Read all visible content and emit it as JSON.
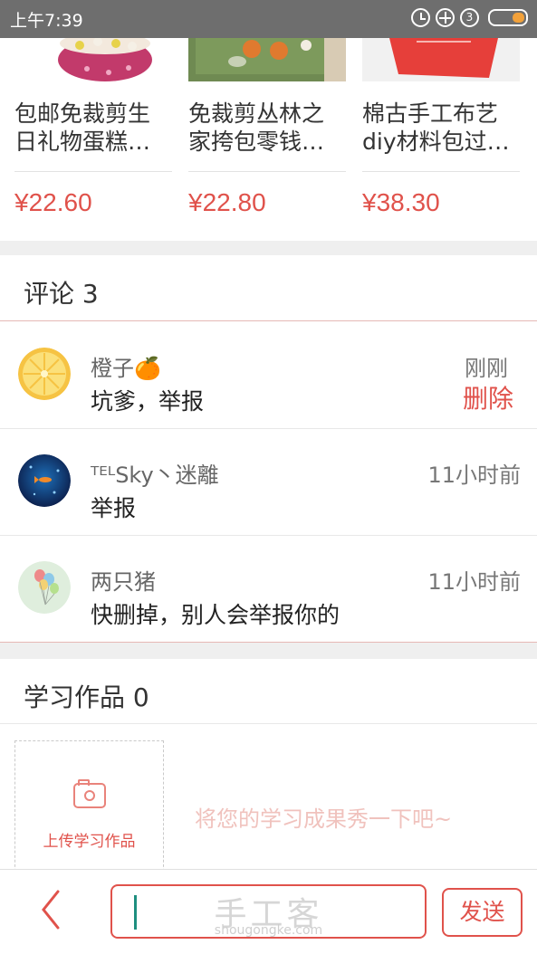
{
  "status_bar": {
    "time": "上午7:39",
    "sim_label": "3",
    "battery_level": 0.35,
    "battery_color": "#f2a13a"
  },
  "products": [
    {
      "name": "包邮免裁剪生日礼物蛋糕…",
      "price": "¥22.60",
      "thumb_color": "#f4eef1"
    },
    {
      "name": "免裁剪丛林之家挎包零钱…",
      "price": "¥22.80",
      "thumb_color": "#6f8a52"
    },
    {
      "name": "棉古手工布艺diy材料包过…",
      "price": "¥38.30",
      "thumb_color": "#e63f3a"
    }
  ],
  "comments_section": {
    "title": "评论 3",
    "items": [
      {
        "user": "橙子🍊",
        "text": "坑爹，举报",
        "time": "刚刚",
        "delete_label": "删除",
        "avatar": "orange-slice-avatar"
      },
      {
        "user": "ᵀᴱᴸSky丶迷離",
        "text": "举报",
        "time": "11小时前",
        "avatar": "fish-avatar"
      },
      {
        "user": "两只猪",
        "text": "快删掉，别人会举报你的",
        "time": "11小时前",
        "avatar": "balloons-avatar"
      }
    ]
  },
  "works_section": {
    "title": "学习作品 0",
    "upload_label": "上传学习作品",
    "empty_hint": "将您的学习成果秀一下吧~"
  },
  "bottom_bar": {
    "watermark_cn": "手工客",
    "watermark_en": "shougongke.com",
    "send_label": "发送"
  },
  "colors": {
    "accent": "#e0524b",
    "gap": "#efefef",
    "statusbar": "#6e6e6e"
  }
}
